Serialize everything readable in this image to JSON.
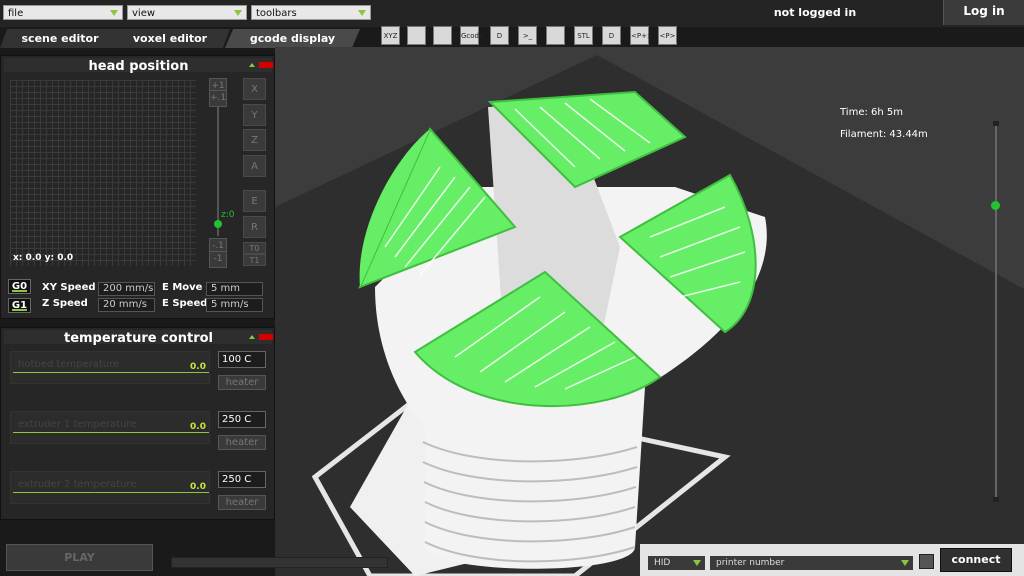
{
  "menu": {
    "file": "file",
    "view": "view",
    "toolbars": "toolbars"
  },
  "header": {
    "status": "not logged in",
    "login": "Log in"
  },
  "tabs": [
    {
      "label": "scene editor"
    },
    {
      "label": "voxel editor"
    },
    {
      "label": "gcode display"
    }
  ],
  "toolbar": [
    {
      "name": "xyz-icon",
      "label": "XYZ"
    },
    {
      "name": "thermometer-icon",
      "label": ""
    },
    {
      "name": "open-folder-icon",
      "label": ""
    },
    {
      "name": "gcode-icon",
      "label": "Gcode"
    },
    {
      "name": "document-d-icon",
      "label": "D"
    },
    {
      "name": "terminal-icon",
      "label": ">_"
    },
    {
      "name": "grid-icon",
      "label": ""
    },
    {
      "name": "stl-icon",
      "label": "STL"
    },
    {
      "name": "document-d2-icon",
      "label": "D"
    },
    {
      "name": "printer-p-plus-icon",
      "label": "<P+>"
    },
    {
      "name": "printer-p-icon",
      "label": "<P>"
    }
  ],
  "head_panel": {
    "title": "head position",
    "xy_readout": "x: 0.0 y: 0.0",
    "jog": {
      "plus1": "+1",
      "plus01": "+.1",
      "minus01": "-.1",
      "minus1": "-1"
    },
    "z_label": "z:0",
    "axes": [
      "X",
      "Y",
      "Z",
      "A",
      "E",
      "R",
      "T0",
      "T1"
    ],
    "g0": "G0",
    "g1": "G1",
    "xy_speed_label": "XY Speed",
    "xy_speed": "200 mm/s",
    "z_speed_label": "Z Speed",
    "z_speed": "20 mm/s",
    "e_move_label": "E Move",
    "e_move": "5 mm",
    "e_speed_label": "E Speed",
    "e_speed": "5 mm/s"
  },
  "temp_panel": {
    "title": "temperature control",
    "rows": [
      {
        "name": "hotbed temperature",
        "value": "0.0",
        "set": "100 C",
        "button": "heater"
      },
      {
        "name": "extruder 1 temperature",
        "value": "0.0",
        "set": "250 C",
        "button": "heater"
      },
      {
        "name": "extruder 2 temperature",
        "value": "0.0",
        "set": "250 C",
        "button": "heater"
      }
    ]
  },
  "bottom": {
    "play": "PLAY"
  },
  "viewport": {
    "time": "Time: 6h 5m",
    "filament": "Filament: 43.44m"
  },
  "connection": {
    "port": "HID",
    "printer": "printer number",
    "connect": "connect"
  },
  "colors": {
    "accent": "#8cc63f",
    "print_green": "#66ee66",
    "knob": "#22c230",
    "alert": "#d40000"
  }
}
